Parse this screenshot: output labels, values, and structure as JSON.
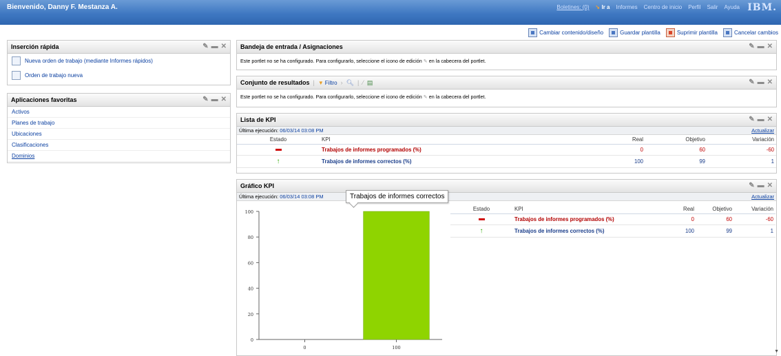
{
  "topbar": {
    "welcome": "Bienvenido, Danny F. Mestanza A.",
    "boletines": "Boletines: (0)",
    "ir_a": "Ir a",
    "informes": "Informes",
    "centro": "Centro de inicio",
    "perfil": "Perfil",
    "salir": "Salir",
    "ayuda": "Ayuda",
    "logo": "IBM."
  },
  "toolbar": {
    "cambiar": "Cambiar contenido/diseño",
    "guardar": "Guardar plantilla",
    "suprimir": "Suprimir plantilla",
    "cancelar": "Cancelar cambios"
  },
  "insercion": {
    "title": "Inserción rápida",
    "items": [
      "Nueva orden de trabajo (mediante Informes rápidos)",
      "Orden de trabajo nueva"
    ]
  },
  "favoritas": {
    "title": "Aplicaciones favoritas",
    "items": [
      "Activos",
      "Planes de trabajo",
      "Ubicaciones",
      "Clasificaciones",
      "Dominios"
    ]
  },
  "bandeja": {
    "title": "Bandeja de entrada / Asignaciones",
    "msg_a": "Este portlet no se ha configurado. Para configurarlo, seleccione el icono de edición",
    "msg_b": "en la cabecera del portlet."
  },
  "conjunto": {
    "title": "Conjunto de resultados",
    "filtro": "Filtro",
    "msg_a": "Este portlet no se ha configurado. Para configurarlo, seleccione el icono de edición",
    "msg_b": "en la cabecera del portlet."
  },
  "kpilist": {
    "title": "Lista de KPI",
    "last_run_label": "Última ejecución:",
    "last_run": "06/03/14 03:08 PM",
    "update": "Actualizar",
    "headers": {
      "estado": "Estado",
      "kpi": "KPI",
      "real": "Real",
      "objetivo": "Objetivo",
      "variacion": "Variación"
    },
    "rows": [
      {
        "kpi": "Trabajos de informes programados (%)",
        "real": "0",
        "objetivo": "60",
        "variacion": "-60"
      },
      {
        "kpi": "Trabajos de informes correctos (%)",
        "real": "100",
        "objetivo": "99",
        "variacion": "1"
      }
    ]
  },
  "kpichart": {
    "title": "Gráfico KPI",
    "last_run_label": "Última ejecución:",
    "last_run": "06/03/14 03:08 PM",
    "update": "Actualizar",
    "tooltip": "Trabajos de informes correctos",
    "headers": {
      "estado": "Estado",
      "kpi": "KPI",
      "real": "Real",
      "objetivo": "Objetivo",
      "variacion": "Variación"
    },
    "rows": [
      {
        "kpi": "Trabajos de informes programados (%)",
        "real": "0",
        "objetivo": "60",
        "variacion": "-60"
      },
      {
        "kpi": "Trabajos de informes correctos (%)",
        "real": "100",
        "objetivo": "99",
        "variacion": "1"
      }
    ]
  },
  "colors": {
    "red": "#b20000",
    "blue": "#1a3d8a",
    "bar": "#8fd400",
    "header": "#3f78c2"
  },
  "chart_data": {
    "type": "bar",
    "categories": [
      "0",
      "100"
    ],
    "values": [
      0,
      100
    ],
    "yticks": [
      0,
      20,
      40,
      60,
      80,
      100
    ],
    "ylim": [
      0,
      100
    ]
  }
}
